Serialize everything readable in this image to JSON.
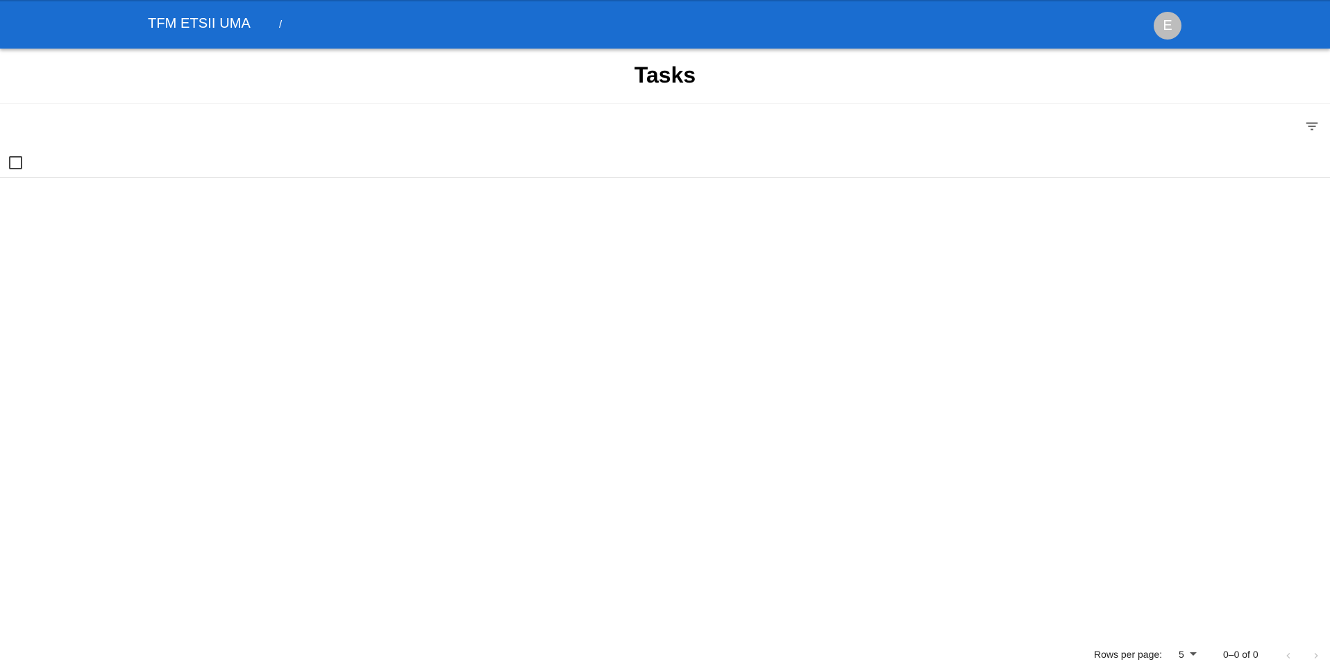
{
  "app_bar": {
    "title": "TFM ETSII UMA",
    "breadcrumb_separator": "/",
    "avatar_initial": "E",
    "background_color": "#1a6dd0"
  },
  "page": {
    "title": "Tasks"
  },
  "toolbar": {
    "filter_icon": "filter-list-icon"
  },
  "table": {
    "select_all_checked": false,
    "rows": []
  },
  "pagination": {
    "rows_per_page_label": "Rows per page:",
    "rows_per_page_value": "5",
    "range_text": "0–0 of 0",
    "prev_icon": "chevron-left-icon",
    "next_icon": "chevron-right-icon",
    "prev_disabled": true,
    "next_disabled": true
  }
}
